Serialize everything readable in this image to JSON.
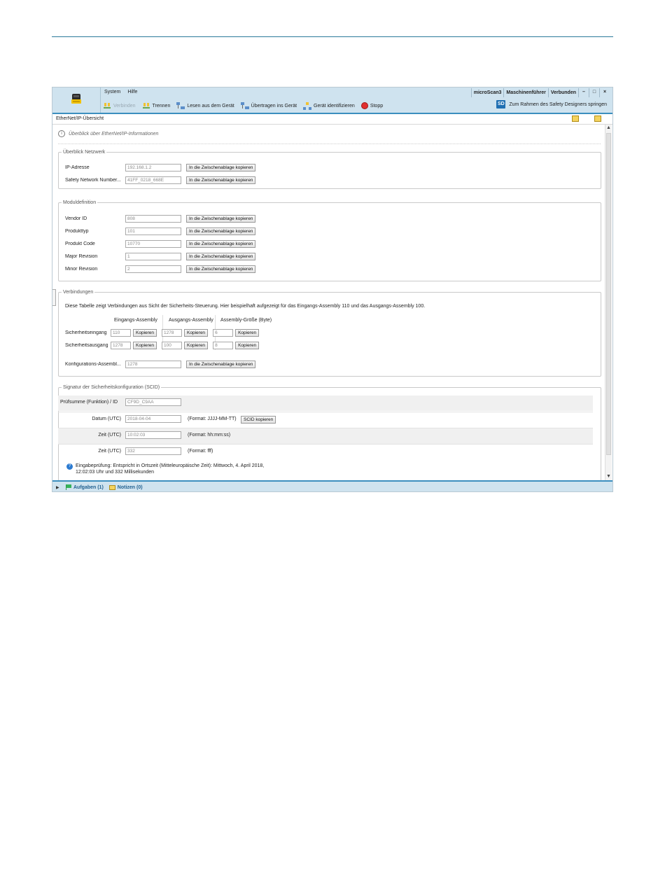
{
  "menu": {
    "system": "System",
    "help": "Hilfe"
  },
  "status": {
    "device": "microScan3",
    "role": "Maschinenführer",
    "connection": "Verbunden"
  },
  "window_controls": {
    "minimize": "–",
    "maximize": "□",
    "close": "×"
  },
  "toolbar": {
    "connect": "Verbinden",
    "disconnect": "Trennen",
    "read": "Lesen aus dem Gerät",
    "transfer": "Übertragen ins Gerät",
    "identify": "Gerät identifizieren",
    "stop": "Stopp",
    "sd_badge": "SD",
    "safety_designer": "Zum Rahmen des Safety Designers springen"
  },
  "page": {
    "title": "EtherNet/IP-Übersicht",
    "info_icon": "i",
    "info": "Überblick über EtherNet/IP-Informationen"
  },
  "copy_label": "In die Zwischenablage kopieren",
  "network": {
    "legend": "Überblick Netzwerk",
    "rows": [
      {
        "label": "IP-Adresse",
        "value": "192.168.1.2"
      },
      {
        "label": "Safety Network Number...",
        "value": "41FF_0218_668E"
      }
    ]
  },
  "module": {
    "legend": "Moduldefinition",
    "rows": [
      {
        "label": "Vendor ID",
        "value": "808"
      },
      {
        "label": "Produkttyp",
        "value": "101"
      },
      {
        "label": "Produkt Code",
        "value": "10770"
      },
      {
        "label": "Major Revision",
        "value": "1"
      },
      {
        "label": "Minor Revision",
        "value": "2"
      }
    ]
  },
  "connections": {
    "legend": "Verbindungen",
    "description": "Diese Tabelle zeigt Verbindungen aus Sicht der Sicherheits-Steuerung. Hier beispielhaft aufgezeigt für das Eingangs-Assembly 110 und das Ausgangs-Assembly 100.",
    "col_input": "Eingangs-Assembly",
    "col_output": "Ausgangs-Assembly",
    "col_size": "Assembly-Größe (Byte)",
    "copy_short": "Kopieren",
    "rows": [
      {
        "label": "Sicherheitseingang",
        "input": "110",
        "output": "1278",
        "size": "6"
      },
      {
        "label": "Sicherheitsausgang",
        "input": "1278",
        "output": "100",
        "size": "8"
      }
    ],
    "config_label": "Konfigurations-Assembl...",
    "config_value": "1278"
  },
  "scid": {
    "legend": "Signatur der Sicherheitskonfiguration (SCID)",
    "checksum_label": "Prüfsumme (Funktion) / ID",
    "checksum_value": "CF9D_C9AA",
    "date_label": "Datum (UTC)",
    "date_value": "2018-04-04",
    "date_format": "(Format: JJJJ-MM-TT)",
    "copy_scid": "SCID kopieren",
    "time1_label": "Zeit (UTC)",
    "time1_value": "10:02:03",
    "time1_format": "(Format: hh:mm:ss)",
    "time2_label": "Zeit (UTC)",
    "time2_value": "332",
    "time2_format": "(Format: fff)",
    "eval_icon": "?",
    "eval_line1": "Eingabeprüfung: Entspricht in Ortszeit (Mitteleuropäische Zeit): Mittwoch, 4. April 2018,",
    "eval_line2": "12:02:03 Uhr und 332 Millisekunden"
  },
  "scrollbar": {
    "up": "▲",
    "down": "▼"
  },
  "bottom": {
    "expand": "▶",
    "tasks": "Aufgaben (1)",
    "notes": "Notizen (0)"
  }
}
